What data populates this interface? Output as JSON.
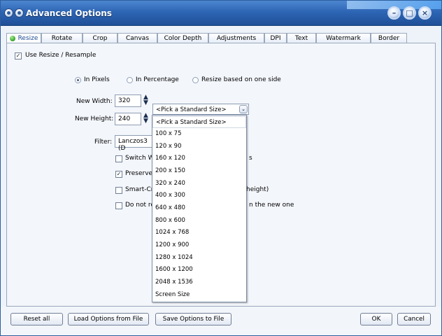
{
  "window": {
    "title": "Advanced Options"
  },
  "tabs": [
    "Resize",
    "Rotate",
    "Crop",
    "Canvas",
    "Color Depth",
    "Adjustments",
    "DPI",
    "Text",
    "Watermark",
    "Border"
  ],
  "resize": {
    "use_resize_label": "Use Resize / Resample",
    "use_resize_checked": true,
    "radio_in_pixels": "In Pixels",
    "radio_in_percentage": "In Percentage",
    "radio_one_side": "Resize based on one side",
    "selected_mode": "In Pixels",
    "new_width_label": "New Width:",
    "new_width_value": "320",
    "new_height_label": "New Height:",
    "new_height_value": "240",
    "standard_size_value": "<Pick a Standard Size>",
    "filter_label": "Filter:",
    "filter_value": "Lanczos3 (D",
    "option_switch_w": "Switch W",
    "option_switch_w_tail": "s",
    "option_preserve": "Preserve",
    "option_smart_crop": "Smart-Cro",
    "option_smart_crop_tail": "height)",
    "option_do_not_res": "Do not res",
    "option_do_not_res_tail": "n the new one"
  },
  "standard_sizes": [
    "<Pick a Standard Size>",
    "100 x 75",
    "120 x 90",
    "160 x 120",
    "200 x 150",
    "320 x 240",
    "400 x 300",
    "640 x 480",
    "800 x 600",
    "1024 x 768",
    "1200 x 900",
    "1280 x 1024",
    "1600 x 1200",
    "2048 x 1536",
    "Screen Size"
  ],
  "buttons": {
    "reset_all": "Reset all",
    "load_options": "Load Options from File",
    "save_options": "Save Options to File",
    "ok": "OK",
    "cancel": "Cancel"
  }
}
